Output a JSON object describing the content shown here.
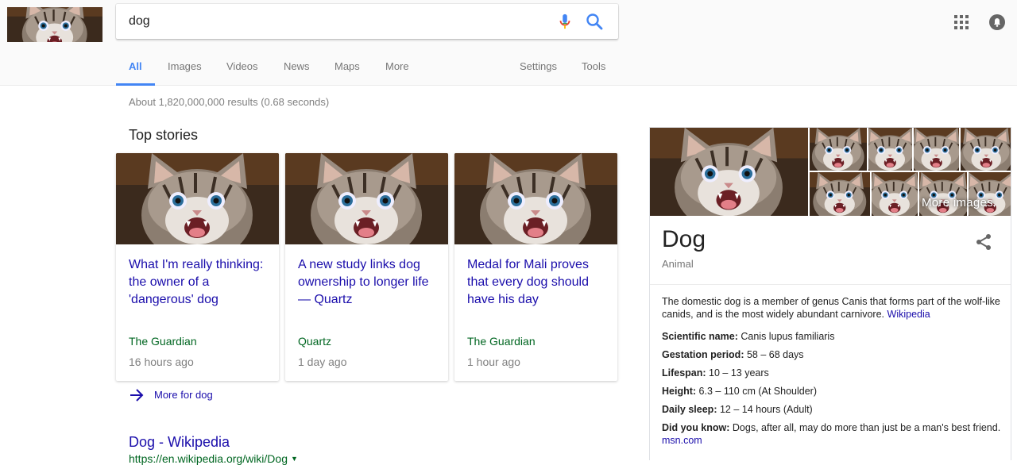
{
  "header": {
    "logo_alt": "kitten logo",
    "search": {
      "query": "dog",
      "placeholder": ""
    },
    "icons": [
      "mic-icon",
      "search-icon",
      "apps-grid-icon",
      "notifications-icon"
    ]
  },
  "tabs": [
    {
      "label": "All",
      "active": true
    },
    {
      "label": "Images"
    },
    {
      "label": "Videos"
    },
    {
      "label": "News"
    },
    {
      "label": "Maps"
    },
    {
      "label": "More"
    },
    {
      "label": "Settings"
    },
    {
      "label": "Tools"
    }
  ],
  "result_stats": "About 1,820,000,000 results (0.68 seconds)",
  "top_stories": {
    "title": "Top stories",
    "items": [
      {
        "headline": "What I'm really thinking: the owner of a 'dangerous' dog",
        "source": "The Guardian",
        "time": "16 hours ago"
      },
      {
        "headline": "A new study links dog ownership to longer life — Quartz",
        "source": "Quartz",
        "time": "1 day ago"
      },
      {
        "headline": "Medal for Mali proves that every dog should have his day",
        "source": "The Guardian",
        "time": "1 hour ago"
      }
    ],
    "more_label": "More for dog"
  },
  "result": {
    "title": "Dog - Wikipedia",
    "url": "https://en.wikipedia.org/wiki/Dog"
  },
  "knowledge_panel": {
    "more_images": "More images",
    "title": "Dog",
    "subtitle": "Animal",
    "description": "The domestic dog is a member of genus Canis that forms part of the wolf-like canids, and is the most widely abundant carnivore.",
    "description_source": "Wikipedia",
    "facts": [
      {
        "label": "Scientific name:",
        "value": "Canis lupus familiaris"
      },
      {
        "label": "Gestation period:",
        "value": "58 – 68 days"
      },
      {
        "label": "Lifespan:",
        "value": "10 – 13 years"
      },
      {
        "label": "Height:",
        "value": "6.3 – 110 cm (At Shoulder)"
      },
      {
        "label": "Daily sleep:",
        "value": "12 – 14 hours (Adult)"
      },
      {
        "label": "Did you know:",
        "value": "Dogs, after all, may do more than just be a man's best friend.",
        "source": "msn.com"
      }
    ]
  },
  "colors": {
    "link": "#1a0dab",
    "url": "#006621",
    "accent": "#4285f4",
    "muted": "#808080"
  }
}
